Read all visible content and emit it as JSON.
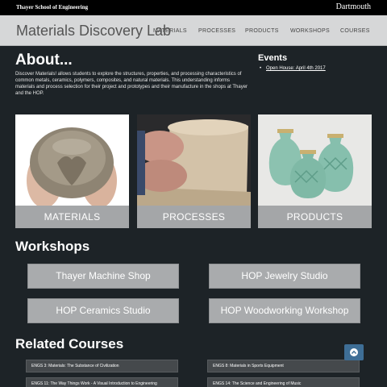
{
  "topbar": {
    "school": "Thayer School of Engineering",
    "brand": "Dartmouth"
  },
  "header": {
    "title": "Materials Discovery Lab",
    "nav": [
      "MATERIALS",
      "PROCESSES",
      "PRODUCTS",
      "WORKSHOPS",
      "COURSES"
    ]
  },
  "about": {
    "heading": "About...",
    "text": "Discover Materials! allows students to explore the structures, properties, and processing characteristics of common metals, ceramics, polymers, composites, and natural materials. This understanding informs materials and process selection for their project and prototypes and their manufacture in the shops at Thayer and the HOP."
  },
  "events": {
    "heading": "Events",
    "items": [
      "Open House: April 4th 2017"
    ]
  },
  "tiles": [
    "MATERIALS",
    "PROCESSES",
    "PRODUCTS"
  ],
  "workshops": {
    "heading": "Workshops",
    "items": [
      "Thayer Machine Shop",
      "HOP Jewelry Studio",
      "HOP Ceramics Studio",
      "HOP Woodworking Workshop"
    ]
  },
  "courses": {
    "heading": "Related Courses",
    "items": [
      "ENGS 3: Materials: The Substance of Civilization",
      "ENGS 8: Materials in Sports Equipment",
      "ENGS 11: The Way Things Work - A Visual Introduction to Engineering",
      "ENGS 14: The Science and Engineering of Music"
    ]
  },
  "icons": {
    "back_to_top": "chevron-up-icon"
  },
  "colors": {
    "background": "#1d2327",
    "header": "#d6d7d8",
    "tile_label": "#a4a6a8",
    "button": "#a9abad",
    "accent": "#3e6e96"
  }
}
